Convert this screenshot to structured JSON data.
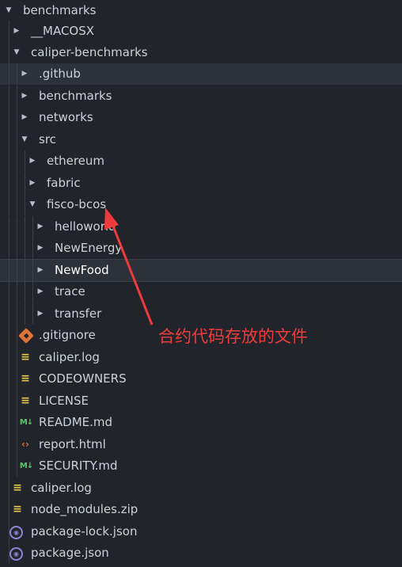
{
  "explorer": {
    "items": [
      {
        "name": "benchmarks",
        "kind": "folder",
        "expanded": true
      },
      {
        "name": "__MACOSX",
        "kind": "folder",
        "expanded": false
      },
      {
        "name": "caliper-benchmarks",
        "kind": "folder",
        "expanded": true
      },
      {
        "name": ".github",
        "kind": "folder",
        "expanded": false
      },
      {
        "name": "benchmarks",
        "kind": "folder",
        "expanded": false
      },
      {
        "name": "networks",
        "kind": "folder",
        "expanded": false
      },
      {
        "name": "src",
        "kind": "folder",
        "expanded": true
      },
      {
        "name": "ethereum",
        "kind": "folder",
        "expanded": false
      },
      {
        "name": "fabric",
        "kind": "folder",
        "expanded": false
      },
      {
        "name": "fisco-bcos",
        "kind": "folder",
        "expanded": true
      },
      {
        "name": "helloworld",
        "kind": "folder",
        "expanded": false
      },
      {
        "name": "NewEnergy",
        "kind": "folder",
        "expanded": false
      },
      {
        "name": "NewFood",
        "kind": "folder",
        "expanded": false,
        "selected": true
      },
      {
        "name": "trace",
        "kind": "folder",
        "expanded": false
      },
      {
        "name": "transfer",
        "kind": "folder",
        "expanded": false
      },
      {
        "name": ".gitignore",
        "kind": "file",
        "icon": "git-icon"
      },
      {
        "name": "caliper.log",
        "kind": "file",
        "icon": "lines-icon"
      },
      {
        "name": "CODEOWNERS",
        "kind": "file",
        "icon": "lines-icon"
      },
      {
        "name": "LICENSE",
        "kind": "file",
        "icon": "lines-icon"
      },
      {
        "name": "README.md",
        "kind": "file",
        "icon": "markdown-icon"
      },
      {
        "name": "report.html",
        "kind": "file",
        "icon": "html-icon"
      },
      {
        "name": "SECURITY.md",
        "kind": "file",
        "icon": "markdown-icon"
      },
      {
        "name": "caliper.log",
        "kind": "file",
        "icon": "lines-icon"
      },
      {
        "name": "node_modules.zip",
        "kind": "file",
        "icon": "lines-icon"
      },
      {
        "name": "package-lock.json",
        "kind": "file",
        "icon": "json-icon"
      },
      {
        "name": "package.json",
        "kind": "file",
        "icon": "json-icon"
      }
    ]
  },
  "annotation": {
    "text": "合约代码存放的文件",
    "color": "#ef3b3b"
  },
  "colors": {
    "background": "#21252b",
    "text": "#cdd1d8",
    "selected_row": "#2c313a"
  }
}
